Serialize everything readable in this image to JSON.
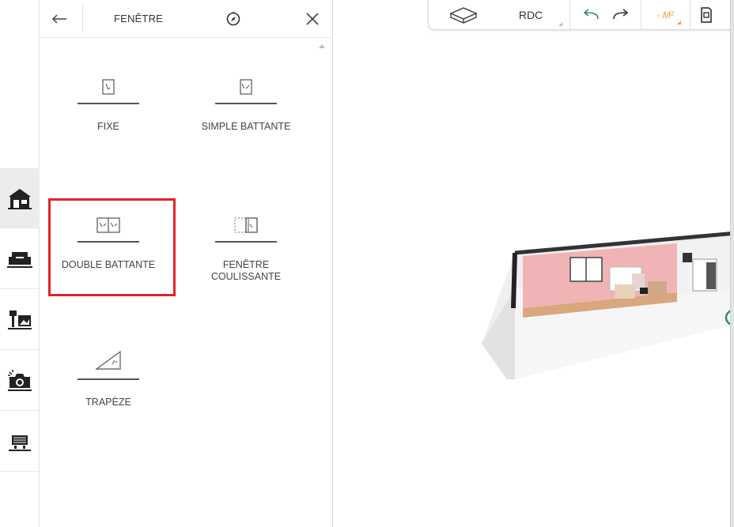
{
  "panel": {
    "title": "FENÊTRE",
    "items": [
      {
        "label": "FIXE"
      },
      {
        "label": "SIMPLE BATTANTE"
      },
      {
        "label": "DOUBLE BATTANTE"
      },
      {
        "label": "FENÊTRE\nCOULISSANTE"
      },
      {
        "label": "TRAPÈZE"
      }
    ]
  },
  "toolbar": {
    "level": "RDC",
    "surface_unit": "- M²"
  },
  "rail": {
    "items": [
      "house-icon",
      "sofa-icon",
      "lamp-frame-icon",
      "camera-icon",
      "cart-icon"
    ],
    "active_index": 0
  },
  "colors": {
    "highlight": "#e0242c",
    "accent": "#f0a030",
    "teal": "#2e8b7a"
  }
}
